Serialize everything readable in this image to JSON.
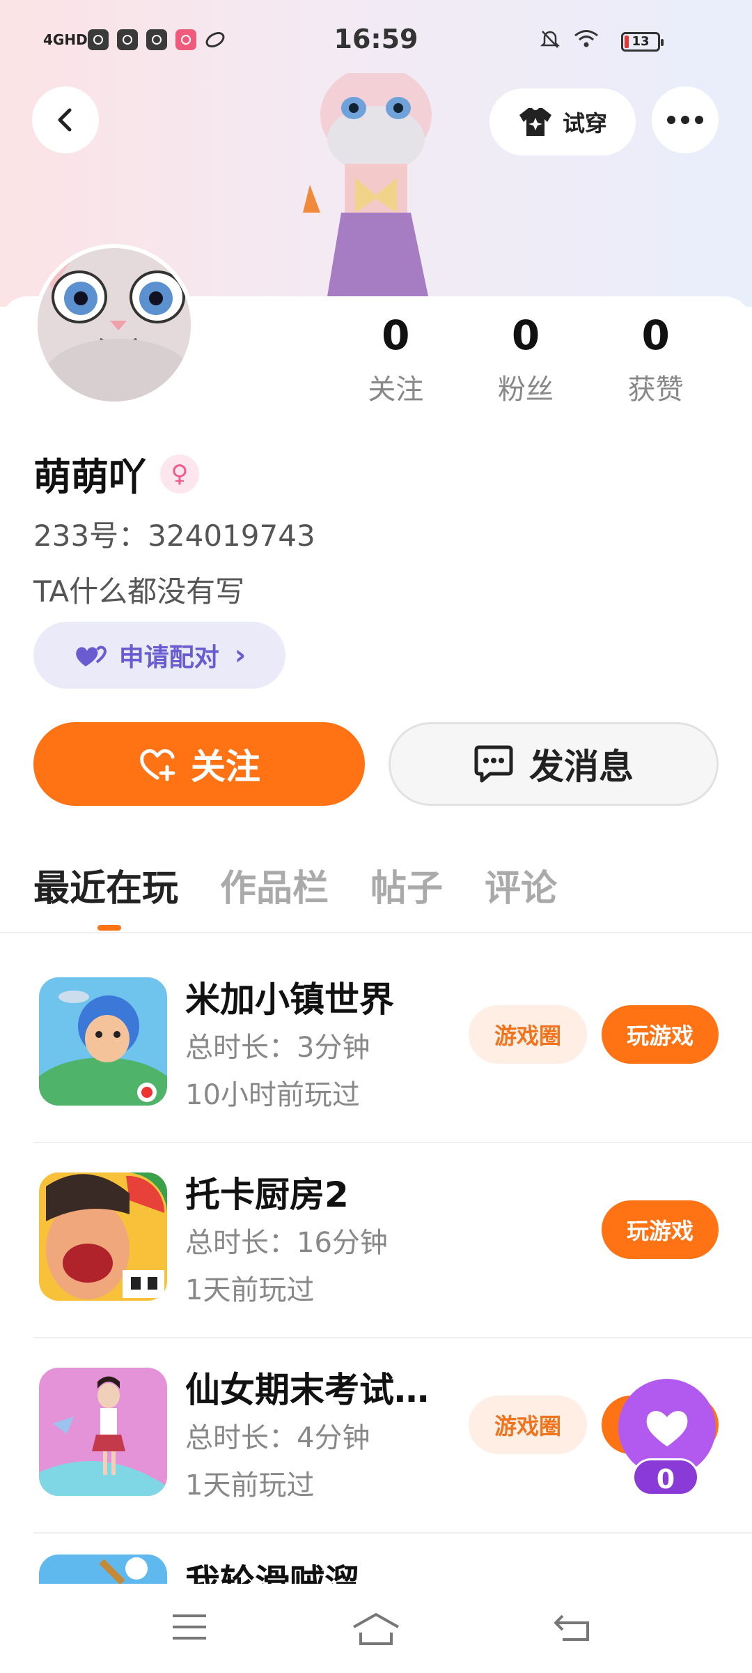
{
  "status": {
    "network": "4GHD",
    "time": "16:59",
    "battery": "13"
  },
  "header": {
    "back_icon": "back-arrow-icon",
    "try_label": "试穿",
    "more_icon": "more-dots-icon"
  },
  "profile": {
    "stats": [
      {
        "num": "0",
        "label": "关注"
      },
      {
        "num": "0",
        "label": "粉丝"
      },
      {
        "num": "0",
        "label": "获赞"
      }
    ],
    "name": "萌萌吖",
    "gender_symbol": "♀",
    "uid": "233号：324019743",
    "bio": "TA什么都没有写",
    "pair_label": "申请配对",
    "pair_arrow": "›"
  },
  "actions": {
    "follow_label": "关注",
    "message_label": "发消息"
  },
  "tabs": [
    "最近在玩",
    "作品栏",
    "帖子",
    "评论"
  ],
  "games": [
    {
      "title": "米加小镇世界",
      "duration": "总时长：3分钟",
      "ago": "10小时前玩过",
      "circle": "游戏圈",
      "play": "玩游戏"
    },
    {
      "title": "托卡厨房2",
      "duration": "总时长：16分钟",
      "ago": "1天前玩过",
      "circle": "",
      "play": "玩游戏"
    },
    {
      "title": "仙女期末考试…",
      "duration": "总时长：4分钟",
      "ago": "1天前玩过",
      "circle": "游戏圈",
      "play": "玩游戏"
    },
    {
      "title": "我轮滑贼溜",
      "duration": "",
      "ago": "",
      "circle": "",
      "play": ""
    }
  ],
  "float": {
    "count": "0",
    "icon": "heart-icon"
  },
  "colors": {
    "accent": "#ff7314",
    "purple": "#b25af0",
    "pair": "#6b5bd1"
  }
}
